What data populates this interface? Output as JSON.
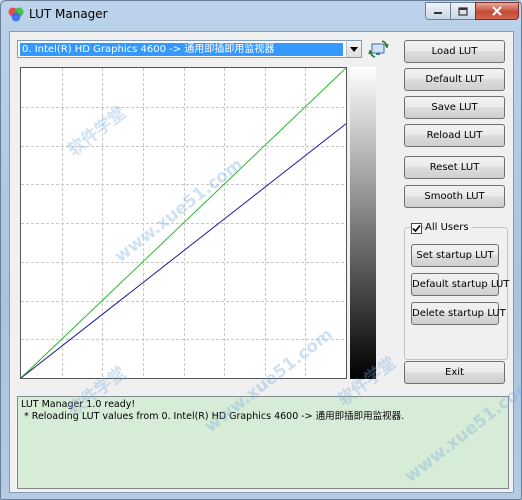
{
  "window": {
    "title": "LUT Manager"
  },
  "device_select": {
    "selected": "0. Intel(R) HD Graphics 4600 -> 通用即插即用监视器"
  },
  "buttons": {
    "load_lut": "Load LUT",
    "default_lut": "Default LUT",
    "save_lut": "Save LUT",
    "reload_lut": "Reload LUT",
    "reset_lut": "Reset LUT",
    "smooth_lut": "Smooth LUT",
    "exit": "Exit"
  },
  "startup_group": {
    "all_users_label": "All Users",
    "all_users_checked": true,
    "set_startup": "Set startup LUT",
    "default_startup": "Default startup LUT",
    "delete_startup": "Delete startup LUT"
  },
  "log": {
    "lines": [
      "LUT Manager 1.0 ready!",
      " * Reloading LUT values from 0. Intel(R) HD Graphics 4600 -> 通用即插即用监视器."
    ]
  },
  "graph": {
    "curves": [
      {
        "color": "#2db82d",
        "x": [
          0,
          1
        ],
        "y": [
          0,
          1
        ]
      },
      {
        "color": "#1c1c99",
        "x": [
          0,
          1
        ],
        "y": [
          0,
          0.82
        ]
      }
    ],
    "grid_divisions": 8,
    "grid_color": "#c8c8c8",
    "ramp": "white-to-black"
  },
  "watermark": {
    "text_cn": "软件学堂",
    "text_url": "www.xue51.com"
  },
  "colors": {
    "selection": "#3399ff",
    "log_background": "#d7ecd7",
    "close_button": "#c44b35"
  }
}
